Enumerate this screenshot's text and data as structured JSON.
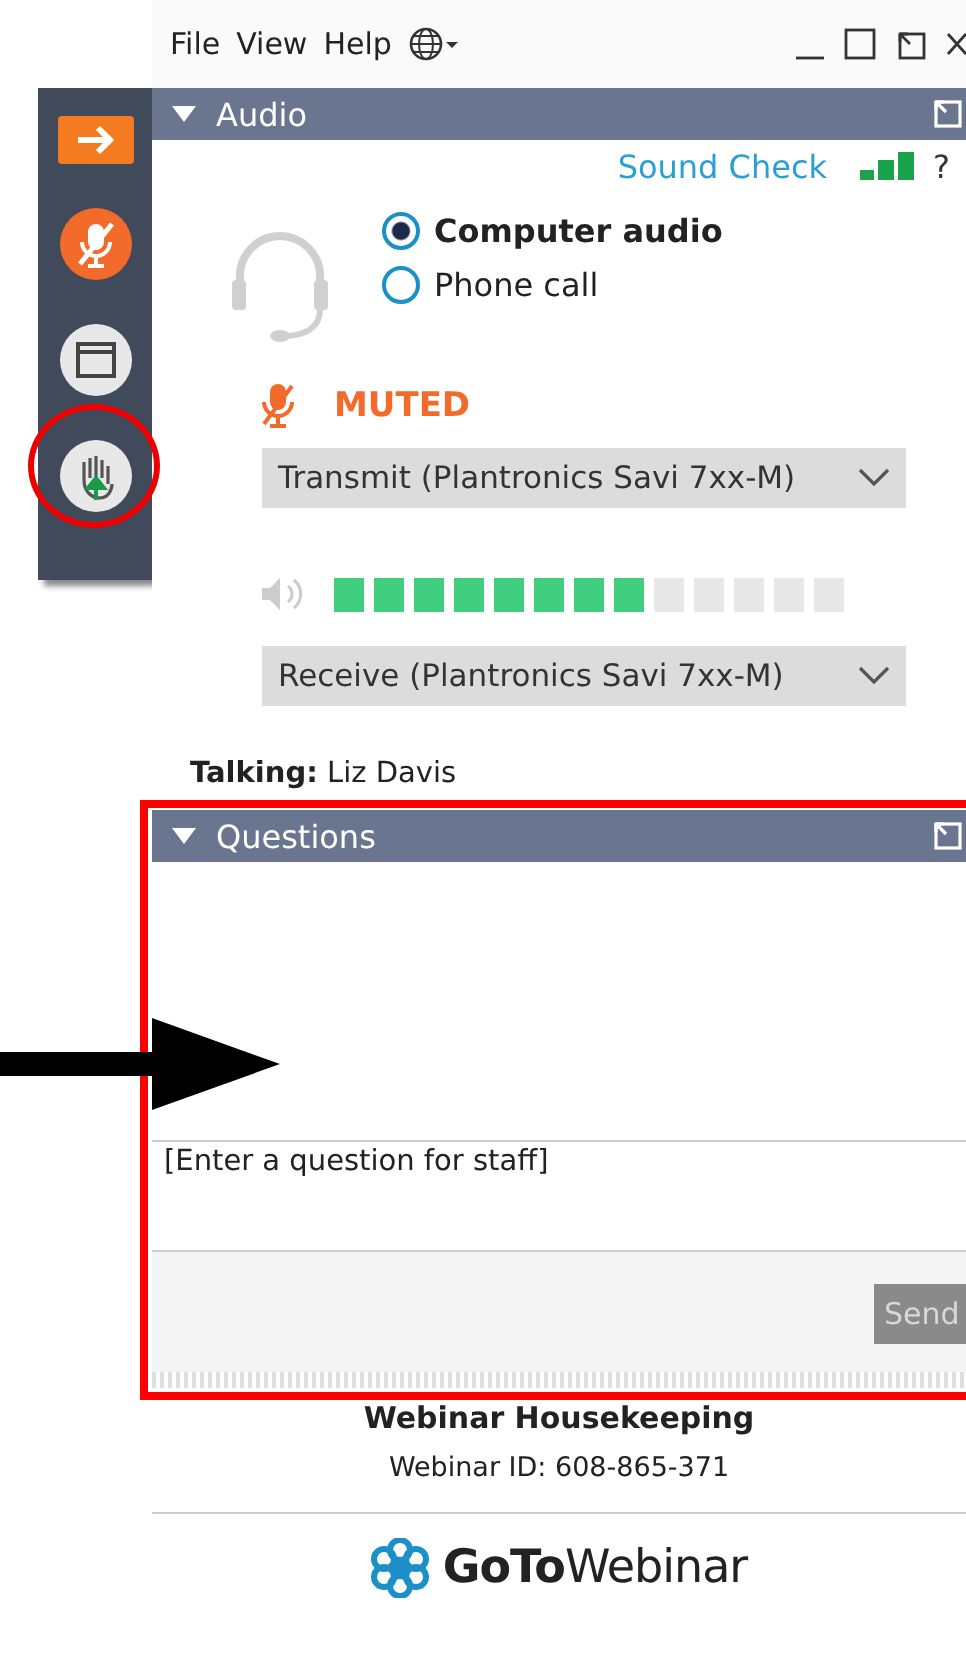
{
  "menu": [
    {
      "label": "File"
    },
    {
      "label": "View"
    },
    {
      "label": "Help"
    }
  ],
  "audio": {
    "title": "Audio",
    "sound_check": "Sound Check",
    "help": "?",
    "options": [
      {
        "label": "Computer audio",
        "selected": true
      },
      {
        "label": "Phone call",
        "selected": false
      }
    ],
    "muted": true,
    "mic_status": "MUTED",
    "transmit": "Transmit (Plantronics Savi 7xx-M)",
    "meter": {
      "level": 0.615
    },
    "receive": "Receive (Plantronics Savi 7xx-M)",
    "talking": "**Talking:** Liz Davis"
  },
  "questions": {
    "title": "Questions",
    "placeholder": "[Enter a question for staff]",
    "send": {
      "label": "Send",
      "disabled": true
    }
  },
  "footer": {
    "title": "Webinar Housekeeping",
    "webinar_id": "Webinar ID: 608-865-371",
    "logo": "**GoTo**Webinar"
  }
}
